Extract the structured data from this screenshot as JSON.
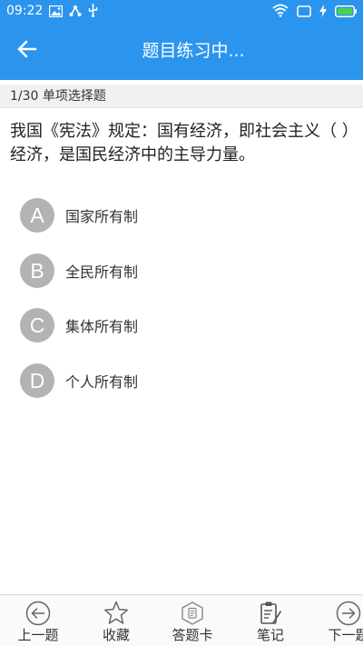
{
  "status_bar": {
    "time": "09:22"
  },
  "app_bar": {
    "title": "题目练习中..."
  },
  "progress": {
    "label": "1/30 单项选择题"
  },
  "question": {
    "text": "我国《宪法》规定：国有经济，即社会主义（  ）经济，是国民经济中的主导力量。"
  },
  "options": [
    {
      "letter": "A",
      "text": "国家所有制"
    },
    {
      "letter": "B",
      "text": "全民所有制"
    },
    {
      "letter": "C",
      "text": "集体所有制"
    },
    {
      "letter": "D",
      "text": "个人所有制"
    }
  ],
  "bottom_nav": {
    "prev": "上一题",
    "favorite": "收藏",
    "answer_card": "答题卡",
    "notes": "笔记",
    "next": "下一题"
  },
  "colors": {
    "primary": "#2b95ee",
    "option_circle": "#b3b3b3"
  }
}
